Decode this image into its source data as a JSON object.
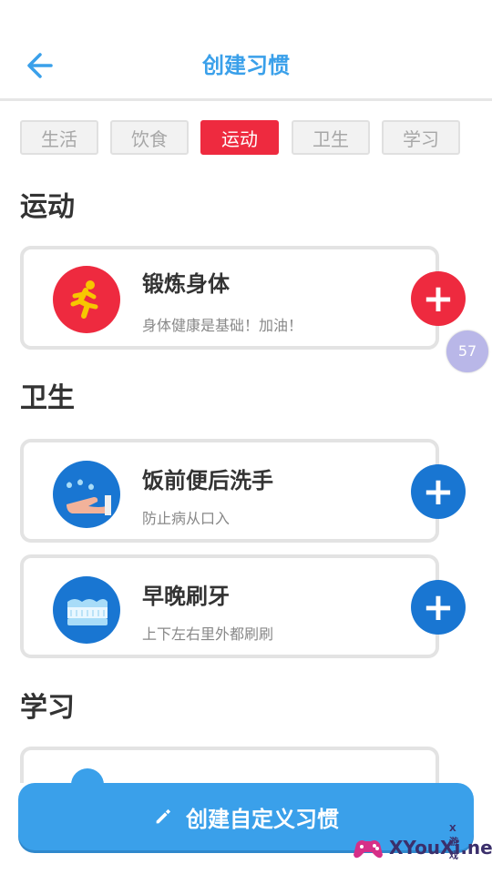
{
  "header": {
    "title": "创建习惯",
    "back_label": ""
  },
  "tabs": [
    {
      "label": "生活",
      "active": false
    },
    {
      "label": "饮食",
      "active": false
    },
    {
      "label": "运动",
      "active": true
    },
    {
      "label": "卫生",
      "active": false
    },
    {
      "label": "学习",
      "active": false
    }
  ],
  "sections": {
    "sport": {
      "title": "运动"
    },
    "hygiene": {
      "title": "卫生"
    },
    "study": {
      "title": "学习"
    }
  },
  "habits": [
    {
      "name": "锻炼身体",
      "desc": "身体健康是基础！加油！",
      "icon": "runner-icon",
      "color": "#ee2a3f"
    },
    {
      "name": "饭前便后洗手",
      "desc": "防止病从口入",
      "icon": "handwash-icon",
      "color": "#1976d2"
    },
    {
      "name": "早晚刷牙",
      "desc": "上下左右里外都刷刷",
      "icon": "toothbrush-icon",
      "color": "#1976d2"
    }
  ],
  "floating_badge": "57",
  "bottom_button": {
    "label": "创建自定义习惯",
    "icon": "pencil-icon"
  },
  "watermark": {
    "small": "X游戏",
    "big": "XYouXi.net"
  },
  "colors": {
    "accent": "#3aa0ea",
    "red": "#ee2a3f",
    "blue": "#1976d2"
  }
}
